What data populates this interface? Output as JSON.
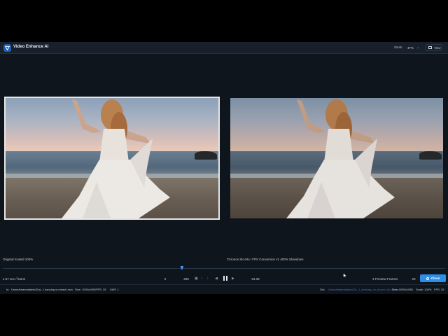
{
  "app": {
    "title": "Video Enhance AI",
    "brand_color": "#1e5fb8",
    "accent_color": "#2d8ee8"
  },
  "header": {
    "zoom_label": "Zoom",
    "zoom_value": "47%",
    "view_label": "View"
  },
  "panes": {
    "left_label": "Original Scaled 100%",
    "right_label": "Chronos Slo-Mo / FPS Conversion v1 400% Slowdown"
  },
  "timeline": {
    "position_fraction": 0.405
  },
  "controls": {
    "frame_rate": "1.67 sec / frame",
    "range_start": "0",
    "range_end": "289",
    "current_time": "94.39",
    "preview_frames_label": "4 Preview Frames",
    "preview_frames_value": "20",
    "close_label": "Close"
  },
  "status": {
    "in_label": "In:",
    "in_path": "Users/brianmatiash/Doc...l dancing on beach.mov",
    "in_size": "Size: 1920x1080",
    "in_fps": "FPS: 25",
    "in_sar": "SAR: 1",
    "out_label": "Out:",
    "out_path": "Users/brianmatiash/Do...l_dancing_on_beach_chr-4x.mov",
    "out_size": "Size: 1920x1080",
    "out_scale": "Scale: 100%",
    "out_fps": "FPS: 25"
  },
  "icons": {
    "logo": "topaz-logo-icon",
    "view": "view-layout-icon",
    "close": "gear-icon",
    "play_controls": [
      "camera-icon",
      "clip-icon",
      "skip-back-icon",
      "pause-icon",
      "skip-forward-icon"
    ]
  }
}
